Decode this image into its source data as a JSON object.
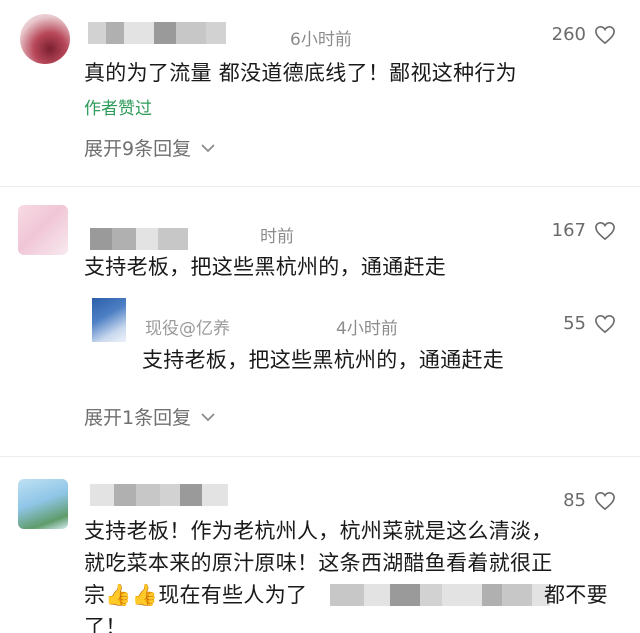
{
  "comments": [
    {
      "time": "6小时前",
      "likes": "260",
      "text": "真的为了流量 都没道德底线了！鄙视这种行为",
      "badge": "作者赞过",
      "expand": "展开9条回复"
    },
    {
      "time": "时前",
      "likes": "167",
      "text": "支持老板，把这些黑杭州的，通通赶走",
      "reply": {
        "user": "现役@亿养",
        "time": "4小时前",
        "likes": "55",
        "text": "支持老板，把这些黑杭州的，通通赶走"
      },
      "expand": "展开1条回复"
    },
    {
      "likes": "85",
      "lines": [
        "支持老板！作为老杭州人，杭州菜就是这么清淡，",
        "就吃菜本来的原汁原味！这条西湖醋鱼看着就很正",
        "宗👍👍现在有些人为了",
        "都不要",
        "了！"
      ]
    }
  ],
  "icons": {
    "like": "heart-outline-icon",
    "expand": "chevron-down-icon"
  }
}
